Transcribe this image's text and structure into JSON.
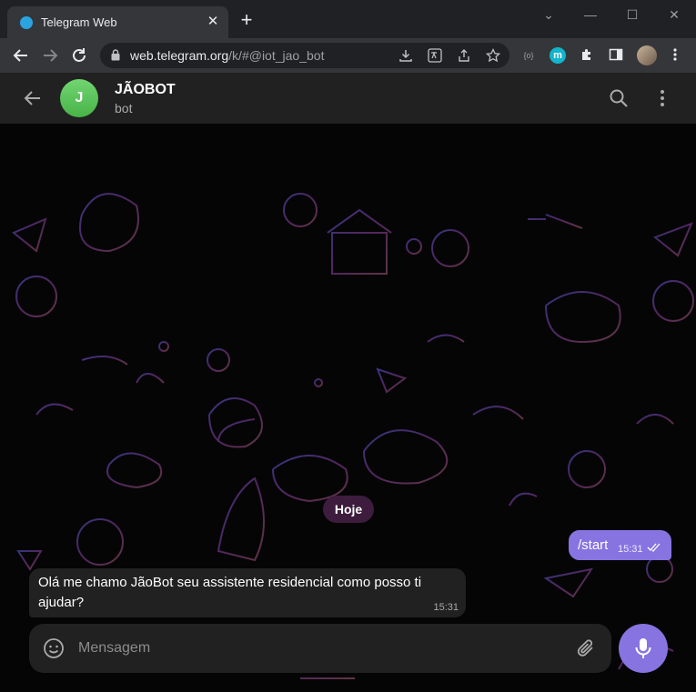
{
  "browser": {
    "tab_title": "Telegram Web",
    "tab_close": "✕",
    "new_tab": "+",
    "url_host": "web.telegram.org",
    "url_path": "/k/#@iot_jao_bot",
    "window_controls": {
      "minimize": "—",
      "maximize": "☐",
      "close": "✕",
      "dropdown": "⌄"
    },
    "icons": [
      "back-icon",
      "forward-icon",
      "reload-icon",
      "lock-icon",
      "install-icon",
      "translate-icon",
      "share-icon",
      "bookmark-star-icon",
      "extension-generic-icon",
      "extension-m-icon",
      "puzzle-icon",
      "sidepanel-icon",
      "profile-avatar",
      "menu-kebab-icon"
    ],
    "ext_m_label": "m",
    "ext_generic_label": "{o}"
  },
  "chat": {
    "avatar_letter": "J",
    "title": "JÃOBOT",
    "status": "bot",
    "avatar_color": "#5fc35f",
    "accent": "#8774e1",
    "date_separator": "Hoje",
    "messages": [
      {
        "direction": "out",
        "text": "/start",
        "time": "15:31",
        "read": true
      },
      {
        "direction": "in",
        "text": "Olá me chamo JãoBot seu assistente residencial como posso ti ajudar?",
        "time": "15:31"
      }
    ],
    "composer_placeholder": "Mensagem"
  }
}
